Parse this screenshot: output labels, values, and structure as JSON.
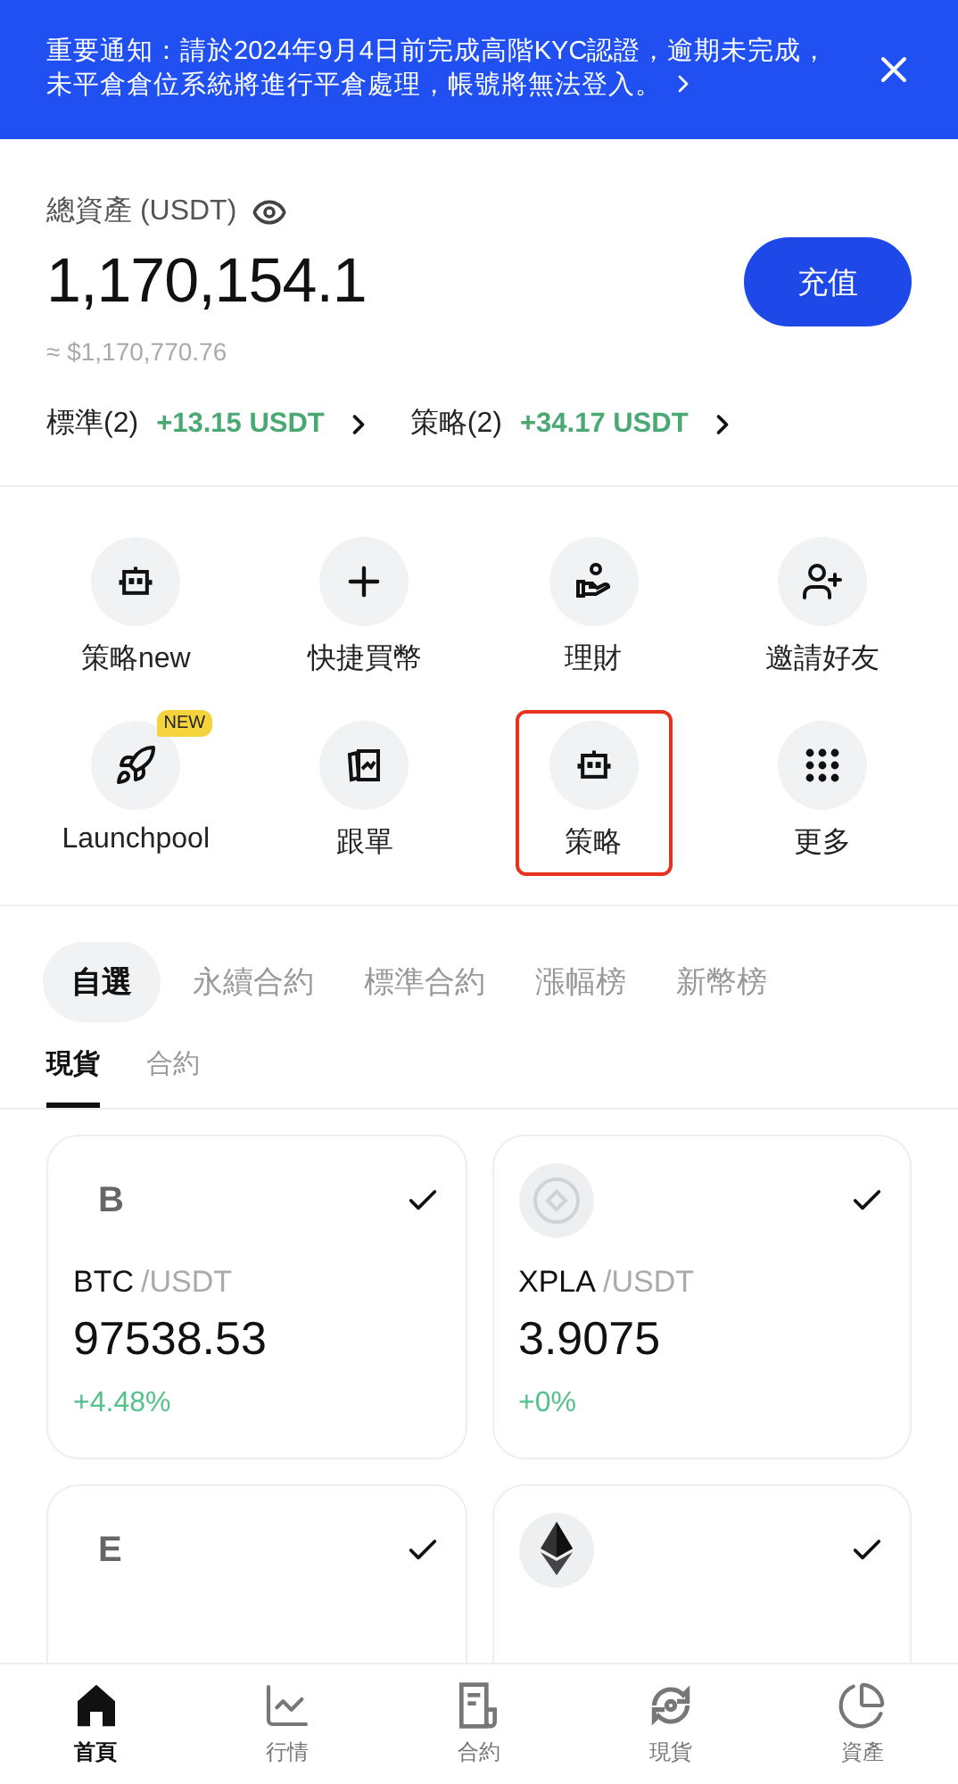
{
  "notice": {
    "text": "重要通知：請於2024年9月4日前完成高階KYC認證，逾期未完成，未平倉倉位系統將進行平倉處理，帳號將無法登入。"
  },
  "assets": {
    "label": "總資產 (USDT)",
    "amount": "1,170,154.1",
    "fiat": "≈ $1,170,770.76",
    "deposit_button": "充值",
    "pnl": [
      {
        "label": "標準(2)",
        "value": "+13.15 USDT"
      },
      {
        "label": "策略(2)",
        "value": "+34.17 USDT"
      }
    ]
  },
  "shortcuts": [
    {
      "label": "策略new",
      "highlighted": false
    },
    {
      "label": "快捷買幣",
      "highlighted": false
    },
    {
      "label": "理財",
      "highlighted": false
    },
    {
      "label": "邀請好友",
      "highlighted": false
    },
    {
      "label": "Launchpool",
      "badge": "NEW",
      "highlighted": false
    },
    {
      "label": "跟單",
      "highlighted": false
    },
    {
      "label": "策略",
      "highlighted": true
    },
    {
      "label": "更多",
      "highlighted": false
    }
  ],
  "market_tabs": [
    {
      "label": "自選",
      "selected": true
    },
    {
      "label": "永續合約",
      "selected": false
    },
    {
      "label": "標準合約",
      "selected": false
    },
    {
      "label": "漲幅榜",
      "selected": false
    },
    {
      "label": "新幣榜",
      "selected": false
    }
  ],
  "sub_tabs": [
    {
      "label": "現貨",
      "selected": true
    },
    {
      "label": "合約",
      "selected": false
    }
  ],
  "cards": [
    {
      "kind": "letter",
      "letter": "B",
      "checked": true,
      "pair": "BTC",
      "quote": "/USDT",
      "price": "97538.53",
      "change": "+4.48%"
    },
    {
      "kind": "logo",
      "checked": true,
      "pair": "XPLA",
      "quote": "/USDT",
      "price": "3.9075",
      "change": "+0%"
    },
    {
      "kind": "letter",
      "letter": "E",
      "checked": true
    },
    {
      "kind": "eth",
      "checked": true
    }
  ],
  "bottom_nav": [
    {
      "label": "首頁",
      "selected": true
    },
    {
      "label": "行情",
      "selected": false
    },
    {
      "label": "合約",
      "selected": false
    },
    {
      "label": "現貨",
      "selected": false
    },
    {
      "label": "資產",
      "selected": false
    }
  ]
}
